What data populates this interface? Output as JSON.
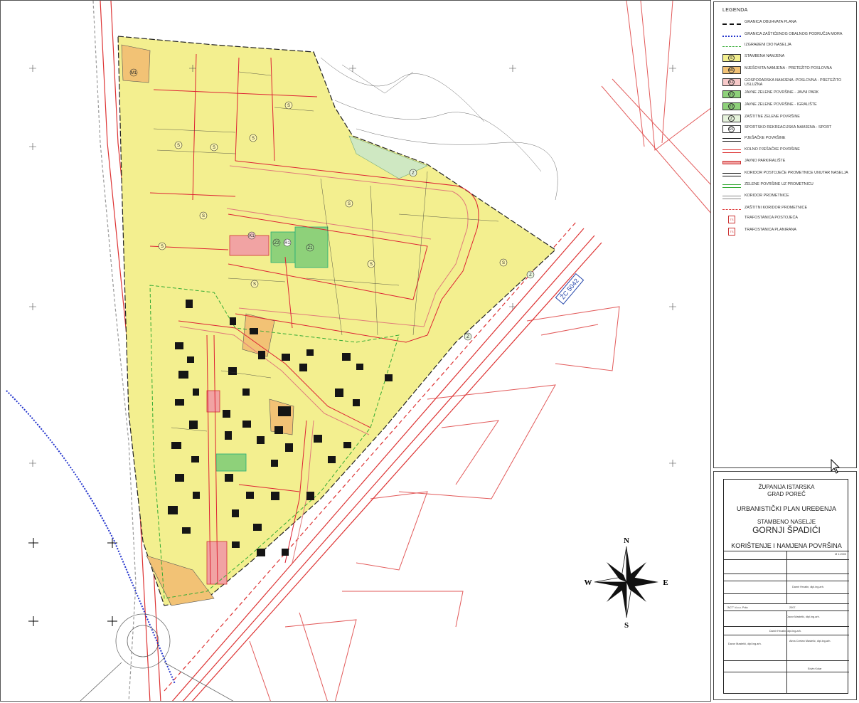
{
  "map": {
    "road_label": "ŽC 5042",
    "compass": {
      "n": "N",
      "s": "S",
      "e": "E",
      "w": "W"
    },
    "zone_labels": [
      "S",
      "Z",
      "Z1",
      "Z2",
      "K1",
      "R1",
      "M1"
    ]
  },
  "legend": {
    "title": "LEGENDA",
    "items": [
      {
        "label": "GRANICA OBUHVATA PLANA",
        "symbol": "dash-black"
      },
      {
        "label": "GRANICA ZAŠTIĆENOG OBALNOG PODRUČJA MORA",
        "symbol": "dots-blue"
      },
      {
        "label": "IZGRAĐENI DIO NASELJA",
        "symbol": "dash-green"
      },
      {
        "label": "STAMBENA NAMJENA",
        "symbol": "fill-yellow",
        "code": "S"
      },
      {
        "label": "MJEŠOVITA NAMJENA - PRETEŽITO POSLOVNA",
        "symbol": "fill-orange",
        "code": "M1"
      },
      {
        "label": "GOSPODARSKA NAMJENA -POSLOVNA - PRETEŽITO USLUŽNA",
        "symbol": "fill-pink",
        "code": "K1"
      },
      {
        "label": "JAVNE ZELENE POVRŠINE - JAVNI PARK",
        "symbol": "fill-green",
        "code": "Z1"
      },
      {
        "label": "JAVNE ZELENE POVRŠINE - IGRALIŠTE",
        "symbol": "fill-green",
        "code": "Z2"
      },
      {
        "label": "ZAŠTITNE ZELENE POVRŠINE",
        "symbol": "fill-lightgreen",
        "code": "Z"
      },
      {
        "label": "SPORTSKO REKREACIJSKA NAMJENA - SPORT",
        "symbol": "fill-white",
        "code": "R1"
      },
      {
        "label": "PJEŠAČKE POVRŠINE",
        "symbol": "line-black-double"
      },
      {
        "label": "KOLNO PJEŠAČKE POVRŠINE",
        "symbol": "line-red-double"
      },
      {
        "label": "JAVNO PARKIRALIŠTE",
        "symbol": "fill-red-double"
      },
      {
        "label": "KORIDOR POSTOJEĆE PROMETNICE UNUTAR NASELJA",
        "symbol": "line-black-double"
      },
      {
        "label": "ZELENE POVRŠINE UZ PROMETNICU",
        "symbol": "line-green-double"
      },
      {
        "label": "KORIDOR PROMETNICE",
        "symbol": "line-grey-double"
      },
      {
        "label": "ZAŠTITNI KORIDOR PROMETNICE",
        "symbol": "dash-red"
      },
      {
        "label": "TRAFOSTANICA POSTOJEĆA",
        "symbol": "box-red",
        "code": "TS"
      },
      {
        "label": "TRAFOSTANICA PLANIRANA",
        "symbol": "box-red",
        "code": "TS"
      }
    ]
  },
  "title_block": {
    "county": "ŽUPANIJA ISTARSKA",
    "city": "GRAD POREČ",
    "plan_type": "URBANISTIČKI PLAN UREĐENJA",
    "settlement_label": "STAMBENO NASELJE",
    "settlement_name": "GORNJI ŠPADIĆI",
    "sheet_title": "KORIŠTENJE I NAMJENA POVRŠINA",
    "scale": "M 1:2000",
    "author_1": "Damir Hrvatin, dipl.ing.arh.",
    "author_2": "Davor Mastelić, dipl.ing.arh.",
    "author_3": "Alma Cvetan Mastelić, dipl.ing.arh.",
    "author_4": "Edvin Kolar",
    "firm": "\"ACT\" d.o.o. Pula",
    "date": "2007."
  }
}
